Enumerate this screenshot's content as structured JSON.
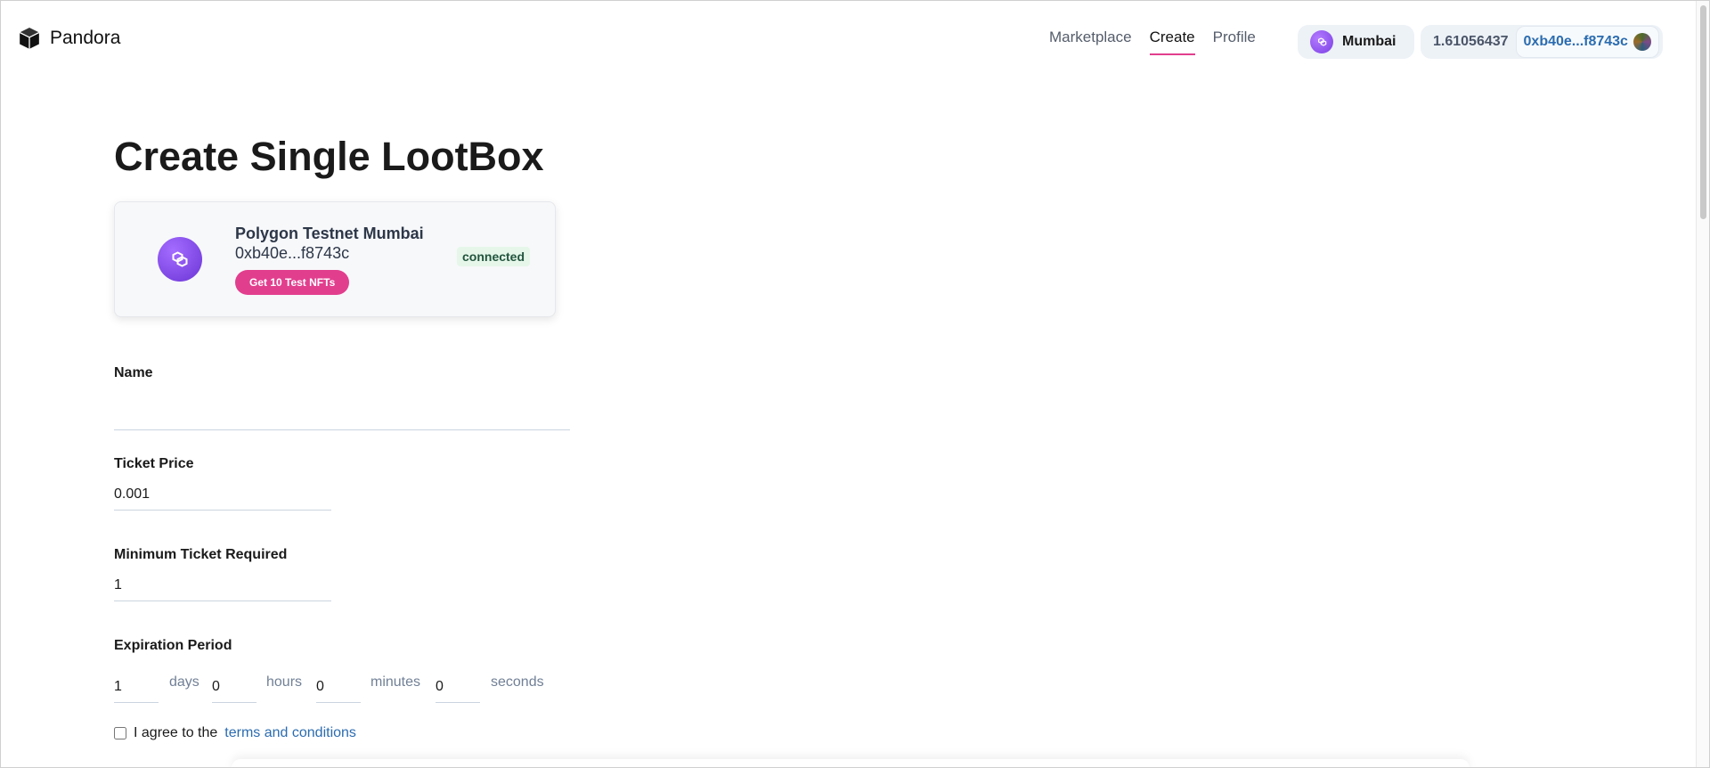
{
  "header": {
    "app_name": "Pandora",
    "nav": [
      {
        "label": "Marketplace",
        "active": false
      },
      {
        "label": "Create",
        "active": true
      },
      {
        "label": "Profile",
        "active": false
      }
    ],
    "chain_label": "Mumbai",
    "balance": "1.61056437",
    "address": "0xb40e...f8743c"
  },
  "page": {
    "title": "Create Single LootBox"
  },
  "network_card": {
    "network_name": "Polygon Testnet Mumbai",
    "address": "0xb40e...f8743c",
    "button_label": "Get 10 Test NFTs",
    "status": "connected"
  },
  "form": {
    "name_label": "Name",
    "name_value": "",
    "price_label": "Ticket Price",
    "price_value": "0.001",
    "min_ticket_label": "Minimum Ticket Required",
    "min_ticket_value": "1",
    "expiration_label": "Expiration Period",
    "days_value": "1",
    "days_unit": "days",
    "hours_value": "0",
    "hours_unit": "hours",
    "minutes_value": "0",
    "minutes_unit": "minutes",
    "seconds_value": "0",
    "seconds_unit": "seconds",
    "agree_text": "I agree to the",
    "terms_link": "terms and conditions"
  },
  "colors": {
    "accent_pink": "#e23e8e",
    "link_blue": "#2b6cb0",
    "polygon_purple": "#7b3fe4",
    "connected_bg": "#e6f7ea"
  }
}
